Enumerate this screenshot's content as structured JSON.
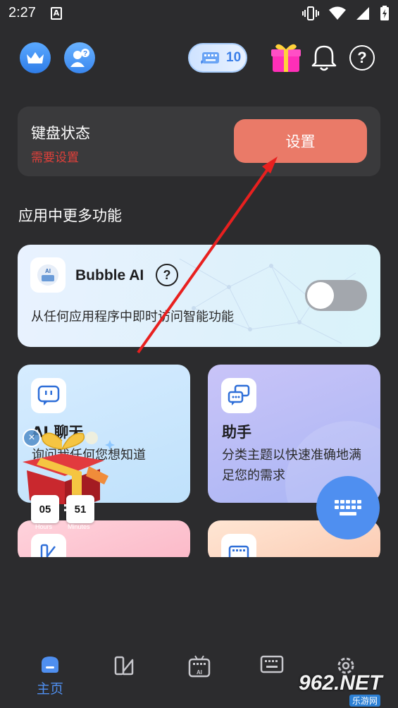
{
  "status_bar": {
    "time": "2:27",
    "notif_letter": "A"
  },
  "topbar": {
    "credits": "10"
  },
  "keyboard_card": {
    "title": "键盘状态",
    "status": "需要设置",
    "button": "设置"
  },
  "section_title": "应用中更多功能",
  "bubble_ai": {
    "name": "Bubble AI",
    "help": "?",
    "description": "从任何应用程序中即时访问智能功能",
    "enabled": false
  },
  "features": [
    {
      "title": "AI 聊天",
      "description": "询问我任何您想知道"
    },
    {
      "title": "助手",
      "description": "分类主题以快速准确地满足您的需求"
    }
  ],
  "gift_timer": {
    "hours": "05",
    "minutes": "51",
    "hours_label": "Hours",
    "minutes_label": "Minutes"
  },
  "bottom_nav": {
    "home_label": "主页"
  },
  "watermark": {
    "brand": "962.NET",
    "sub": "乐游网"
  },
  "colors": {
    "accent": "#4f8ff0",
    "warning": "#e0403a",
    "setup_button": "#ea7a68"
  }
}
